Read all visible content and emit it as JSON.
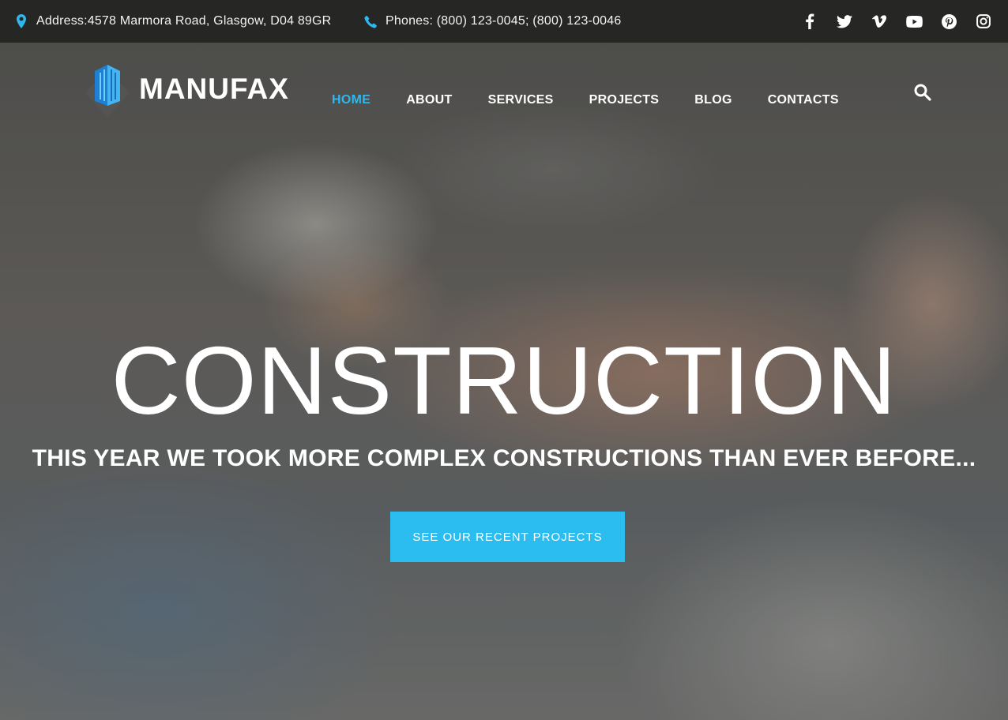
{
  "topbar": {
    "address": "Address:4578 Marmora Road, Glasgow, D04 89GR",
    "phones": "Phones: (800) 123-0045; (800) 123-0046",
    "icons": {
      "address": "map-marker-icon",
      "phone": "phone-icon"
    },
    "accent_color": "#2fb7ee",
    "social": [
      "facebook-icon",
      "twitter-icon",
      "vimeo-icon",
      "youtube-icon",
      "pinterest-icon",
      "instagram-icon"
    ]
  },
  "header": {
    "brand": "MANUFAX",
    "nav": [
      "HOME",
      "ABOUT",
      "SERVICES",
      "PROJECTS",
      "BLOG",
      "CONTACTS"
    ],
    "active_nav": "HOME",
    "active_color": "#2fb7ee"
  },
  "hero": {
    "headline": "CONSTRUCTION",
    "subheadline": "THIS YEAR WE TOOK MORE COMPLEX CONSTRUCTIONS THAN EVER BEFORE...",
    "cta_label": "SEE OUR RECENT PROJECTS",
    "cta_color": "#2bbcf0"
  }
}
